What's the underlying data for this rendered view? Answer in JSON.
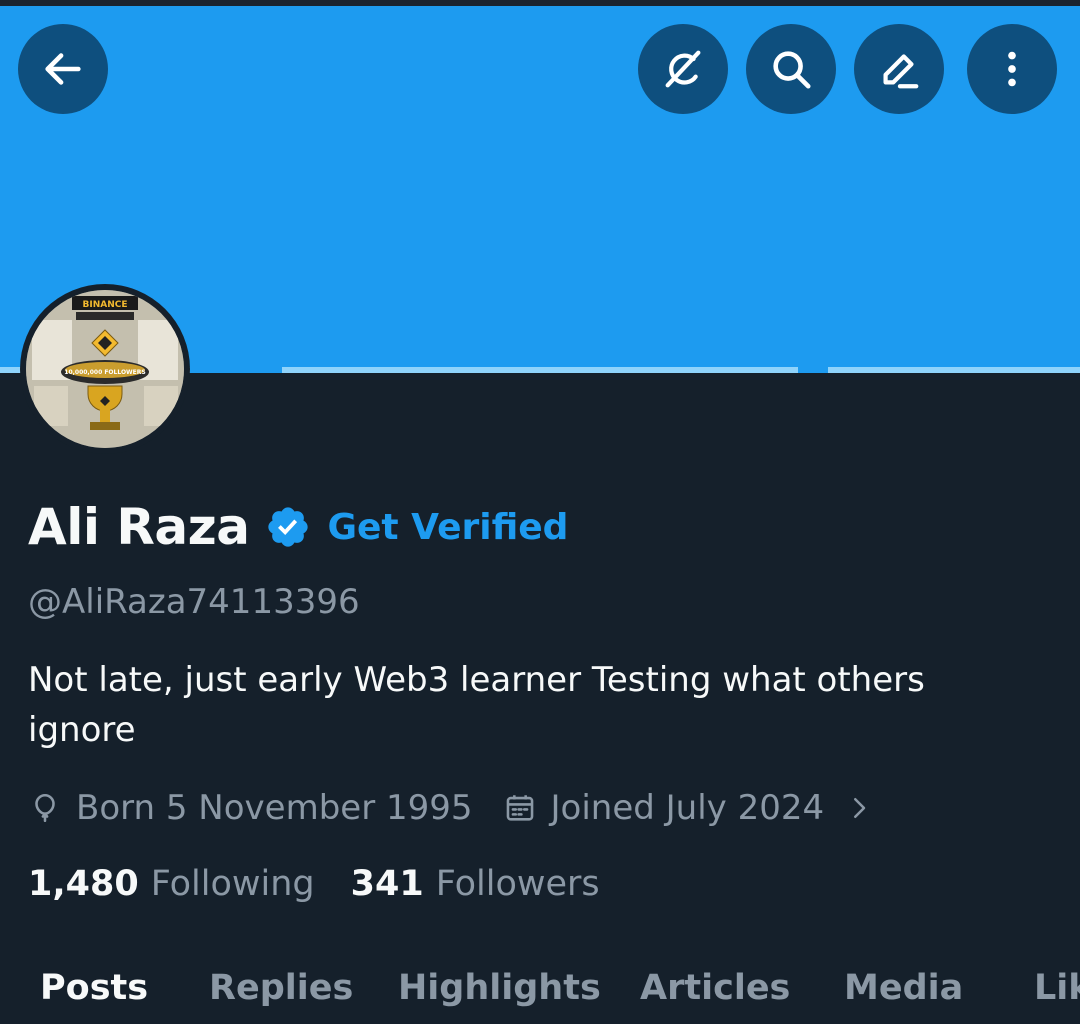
{
  "header": {
    "buttons": [
      {
        "name": "back-button",
        "icon": "arrow-left-icon"
      },
      {
        "name": "grok-button",
        "icon": "grok-icon"
      },
      {
        "name": "search-button",
        "icon": "search-icon"
      },
      {
        "name": "compose-button",
        "icon": "pencil-icon"
      },
      {
        "name": "more-button",
        "icon": "more-vertical-icon"
      }
    ],
    "banner_color": "#1d9bf0"
  },
  "profile": {
    "avatar_logo_text": "BINANCE",
    "avatar_caption": "10,000,000 FOLLOWERS",
    "name": "Ali Raza",
    "verified_icon": "verified-badge-icon",
    "get_verified": "Get Verified",
    "handle": "@AliRaza74113396",
    "bio": "Not late, just early Web3 learner Testing what others ignore",
    "born": "Born 5 November 1995",
    "joined": "Joined July 2024",
    "following_count": "1,480",
    "following_label": "Following",
    "followers_count": "341",
    "followers_label": "Followers"
  },
  "tabs": [
    {
      "label": "Posts",
      "active": true
    },
    {
      "label": "Replies",
      "active": false
    },
    {
      "label": "Highlights",
      "active": false
    },
    {
      "label": "Articles",
      "active": false
    },
    {
      "label": "Media",
      "active": false
    },
    {
      "label": "Likes",
      "active": false
    }
  ],
  "colors": {
    "accent": "#1d9bf0",
    "background": "#15202b",
    "text_primary": "#f7f9f9",
    "text_secondary": "#8b98a5",
    "button_bg": "#0e4f7e"
  }
}
